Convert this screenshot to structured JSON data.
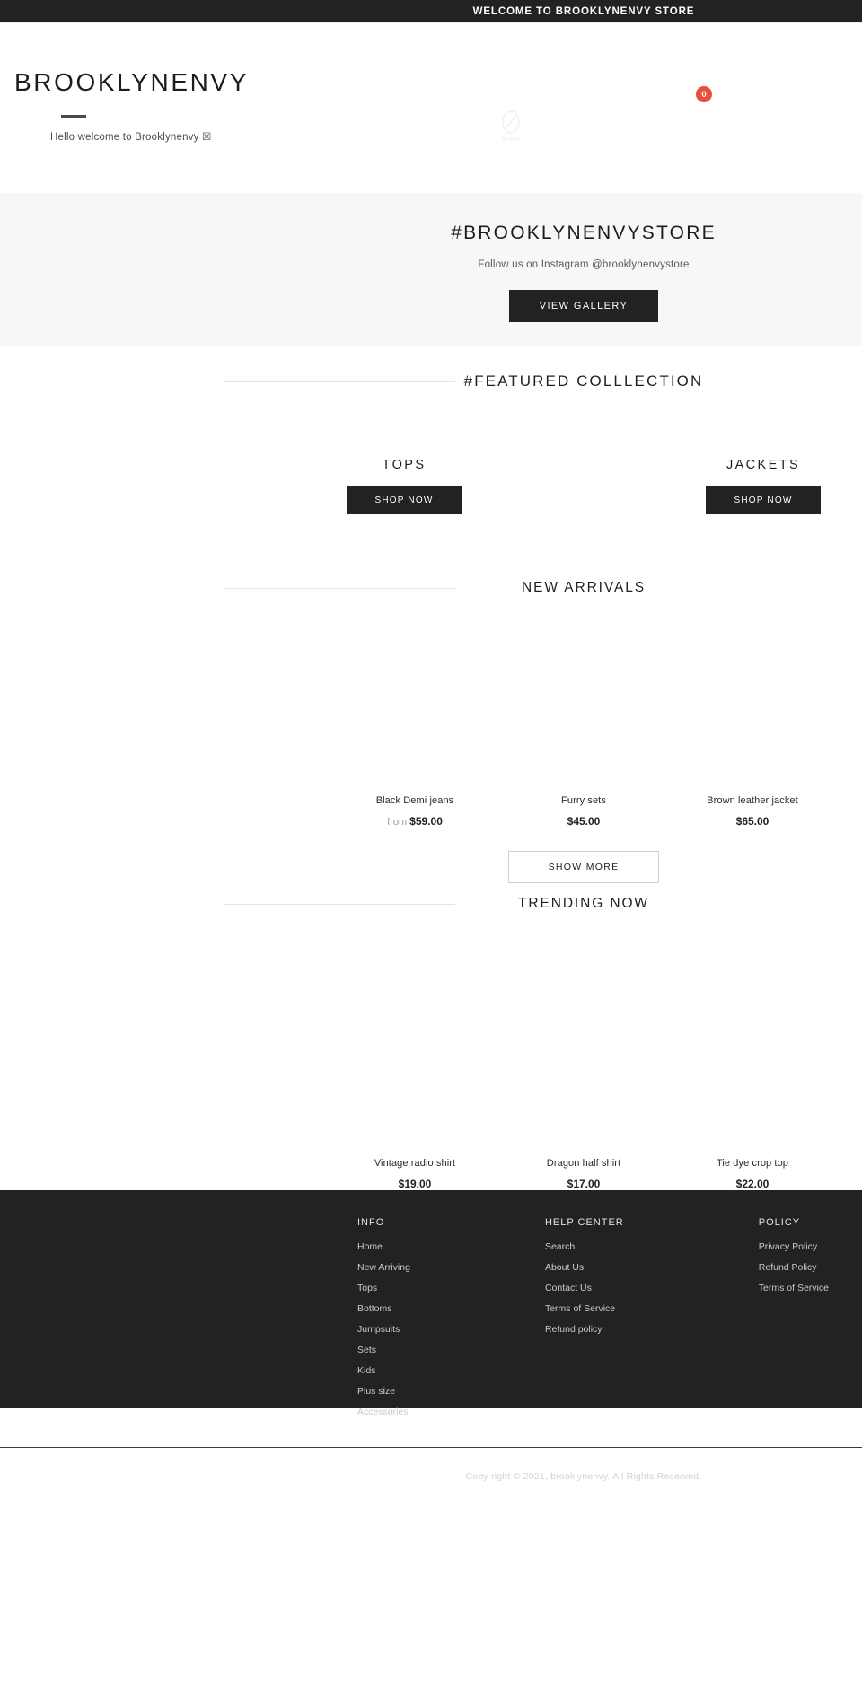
{
  "announcement": {
    "text": "WELCOME TO BROOKLYNENVY STORE"
  },
  "header": {
    "brand_name": "BROOKLYNENVY",
    "tagline": "Hello welcome to Brooklynenvy ☒",
    "no_image_label": "No image",
    "cart_count": "0"
  },
  "instagram": {
    "title": "#BROOKLYNENVYSTORE",
    "subtitle": "Follow us on Instagram @brooklynenvystore",
    "button_label": "VIEW GALLERY"
  },
  "featured": {
    "title": "#FEATURED COLLLECTION",
    "collections": [
      {
        "name": "TOPS",
        "button_label": "SHOP NOW"
      },
      {
        "name": "JACKETS",
        "button_label": "SHOP NOW"
      }
    ]
  },
  "new_arrivals": {
    "title": "NEW ARRIVALS",
    "show_more_label": "SHOW MORE",
    "products": [
      {
        "title": "Black Demi jeans",
        "price_prefix": "from ",
        "price": "$59.00"
      },
      {
        "title": "Furry sets",
        "price_prefix": "",
        "price": "$45.00"
      },
      {
        "title": "Brown leather jacket",
        "price_prefix": "",
        "price": "$65.00"
      }
    ]
  },
  "trending": {
    "title": "TRENDING NOW",
    "products": [
      {
        "title": "Vintage radio shirt",
        "price_prefix": "",
        "price": "$19.00"
      },
      {
        "title": "Dragon half shirt",
        "price_prefix": "",
        "price": "$17.00"
      },
      {
        "title": "Tie dye crop top",
        "price_prefix": "",
        "price": "$22.00"
      }
    ]
  },
  "footer": {
    "columns": [
      {
        "title": "INFO",
        "links": [
          "Home",
          "New Arriving",
          "Tops",
          "Bottoms",
          "Jumpsuits",
          "Sets",
          "Kids",
          "Plus size",
          "Accessories"
        ]
      },
      {
        "title": "HELP CENTER",
        "links": [
          "Search",
          "About Us",
          "Contact Us",
          "Terms of Service",
          "Refund policy"
        ]
      },
      {
        "title": "POLICY",
        "links": [
          "Privacy Policy",
          "Refund Policy",
          "Terms of Service"
        ]
      }
    ],
    "copyright": "Copy right © 2021, brooklynenvy. All Rights Reserved."
  },
  "colors": {
    "dark": "#222222",
    "accent_badge": "#e8503a",
    "band": "#f7f7f7"
  }
}
